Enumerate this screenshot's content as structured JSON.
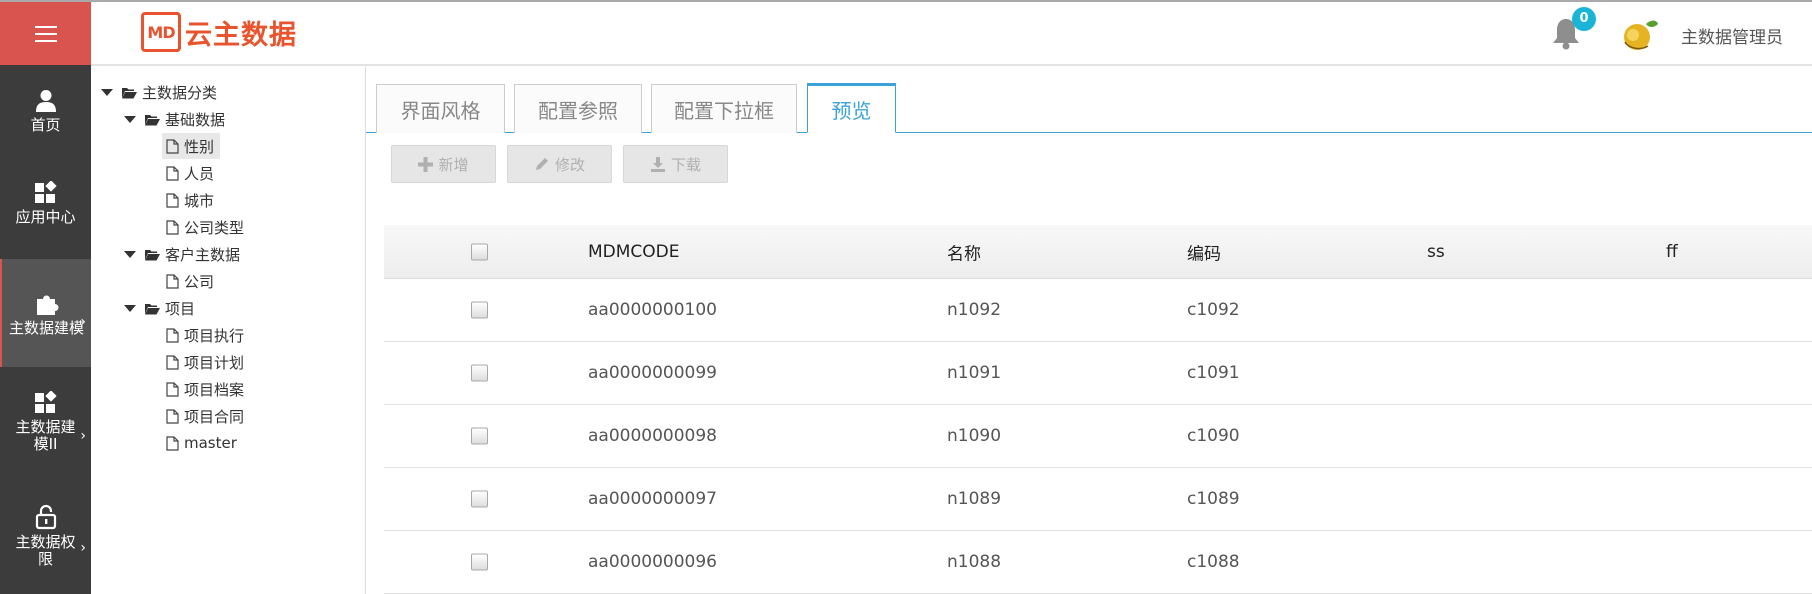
{
  "brand": {
    "logo_mark": "MD",
    "logo_text": "云主数据",
    "accent": "#e8542d"
  },
  "header": {
    "notification_count": "0",
    "user_name": "主数据管理员"
  },
  "sidebar": {
    "items": [
      {
        "label": "首页",
        "icon": "user-icon"
      },
      {
        "label": "应用中心",
        "icon": "apps-icon"
      },
      {
        "label": "主数据建模",
        "icon": "puzzle-icon",
        "active": true
      },
      {
        "label": "主数据建模II",
        "icon": "apps-icon"
      },
      {
        "label": "主数据权限",
        "icon": "lock-icon"
      }
    ]
  },
  "tree": {
    "nodes": [
      {
        "label": "主数据分类",
        "type": "folder"
      },
      {
        "label": "基础数据",
        "type": "folder"
      },
      {
        "label": "性别",
        "type": "file",
        "selected": true
      },
      {
        "label": "人员",
        "type": "file"
      },
      {
        "label": "城市",
        "type": "file"
      },
      {
        "label": "公司类型",
        "type": "file"
      },
      {
        "label": "客户主数据",
        "type": "folder"
      },
      {
        "label": "公司",
        "type": "file"
      },
      {
        "label": "项目",
        "type": "folder"
      },
      {
        "label": "项目执行",
        "type": "file"
      },
      {
        "label": "项目计划",
        "type": "file"
      },
      {
        "label": "项目档案",
        "type": "file"
      },
      {
        "label": "项目合同",
        "type": "file"
      },
      {
        "label": "master",
        "type": "file"
      }
    ]
  },
  "tabs": [
    {
      "label": "界面风格"
    },
    {
      "label": "配置参照"
    },
    {
      "label": "配置下拉框"
    },
    {
      "label": "预览",
      "active": true
    }
  ],
  "toolbar": {
    "add_label": "新增",
    "edit_label": "修改",
    "download_label": "下载"
  },
  "table": {
    "columns": [
      "MDMCODE",
      "名称",
      "编码",
      "ss",
      "ff"
    ],
    "rows": [
      {
        "code": "aa0000000100",
        "name": "n1092",
        "number": "c1092",
        "ss": "",
        "ff": ""
      },
      {
        "code": "aa0000000099",
        "name": "n1091",
        "number": "c1091",
        "ss": "",
        "ff": ""
      },
      {
        "code": "aa0000000098",
        "name": "n1090",
        "number": "c1090",
        "ss": "",
        "ff": ""
      },
      {
        "code": "aa0000000097",
        "name": "n1089",
        "number": "c1089",
        "ss": "",
        "ff": ""
      },
      {
        "code": "aa0000000096",
        "name": "n1088",
        "number": "c1088",
        "ss": "",
        "ff": ""
      }
    ]
  },
  "colors": {
    "sidebar_bg": "#3c3c3c",
    "menu_red": "#d9534f",
    "tab_blue": "#3ca3d8",
    "badge": "#1ab5d6"
  }
}
